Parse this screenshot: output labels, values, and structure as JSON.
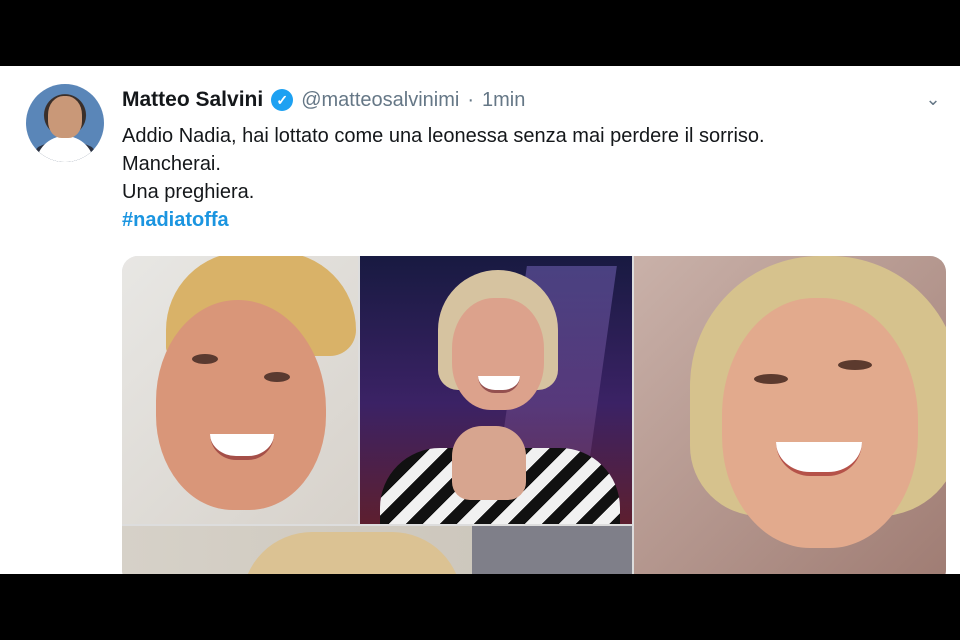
{
  "tweet": {
    "author_name": "Matteo Salvini",
    "handle": "@matteosalvinimi",
    "separator": "·",
    "time": "1min",
    "lines": [
      "Addio Nadia, hai lottato come una leonessa senza mai perdere il sorriso.",
      "Mancherai.",
      "Una preghiera."
    ],
    "hashtag": "#nadiatoffa",
    "icons": {
      "verified": "verified-badge-icon",
      "menu": "chevron-down-icon"
    },
    "colors": {
      "verified": "#1da1f2",
      "hashtag": "#1b95e0",
      "text": "#14171a",
      "meta": "#657786"
    }
  }
}
